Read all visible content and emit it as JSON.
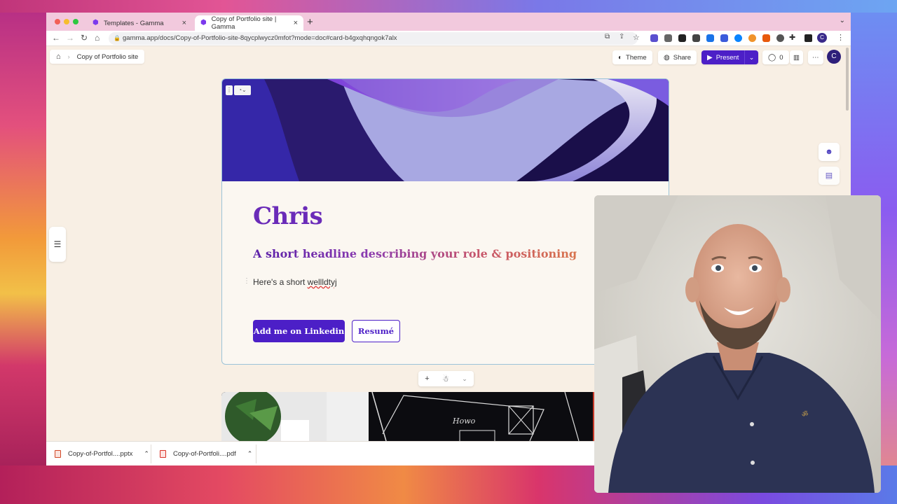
{
  "browser": {
    "tabs": [
      {
        "label": "Templates - Gamma",
        "active": false
      },
      {
        "label": "Copy of Portfolio site | Gamma",
        "active": true
      }
    ],
    "new_tab": "+",
    "url": "gamma.app/docs/Copy-of-Portfolio-site-8qycplwycz0mfot?mode=doc#card-b4gxqhqngok7alx",
    "profile_initial": "C"
  },
  "app": {
    "breadcrumb": "Copy of Portfolio site",
    "theme_label": "Theme",
    "share_label": "Share",
    "present_label": "Present",
    "comment_count": "0",
    "avatar_initial": "C"
  },
  "card": {
    "title": "Chris",
    "subtitle": "A short headline describing your role & positioning",
    "body_prefix": "Here's a short",
    "body_misspelled": "wellldtyj",
    "primary_button": "Add me on Linkedin",
    "secondary_button": "Resumé"
  },
  "card2": {
    "handwriting": "Howo"
  },
  "card_toolbar": {
    "add": "+"
  },
  "downloads": [
    {
      "name": "Copy-of-Portfol....pptx",
      "type": "pptx",
      "color": "#d24726"
    },
    {
      "name": "Copy-of-Portfoli....pdf",
      "type": "pdf",
      "color": "#d93025"
    }
  ],
  "colors": {
    "accent": "#4c1fc7",
    "title": "#6a2bb8",
    "page_bg": "#f8efe4"
  }
}
